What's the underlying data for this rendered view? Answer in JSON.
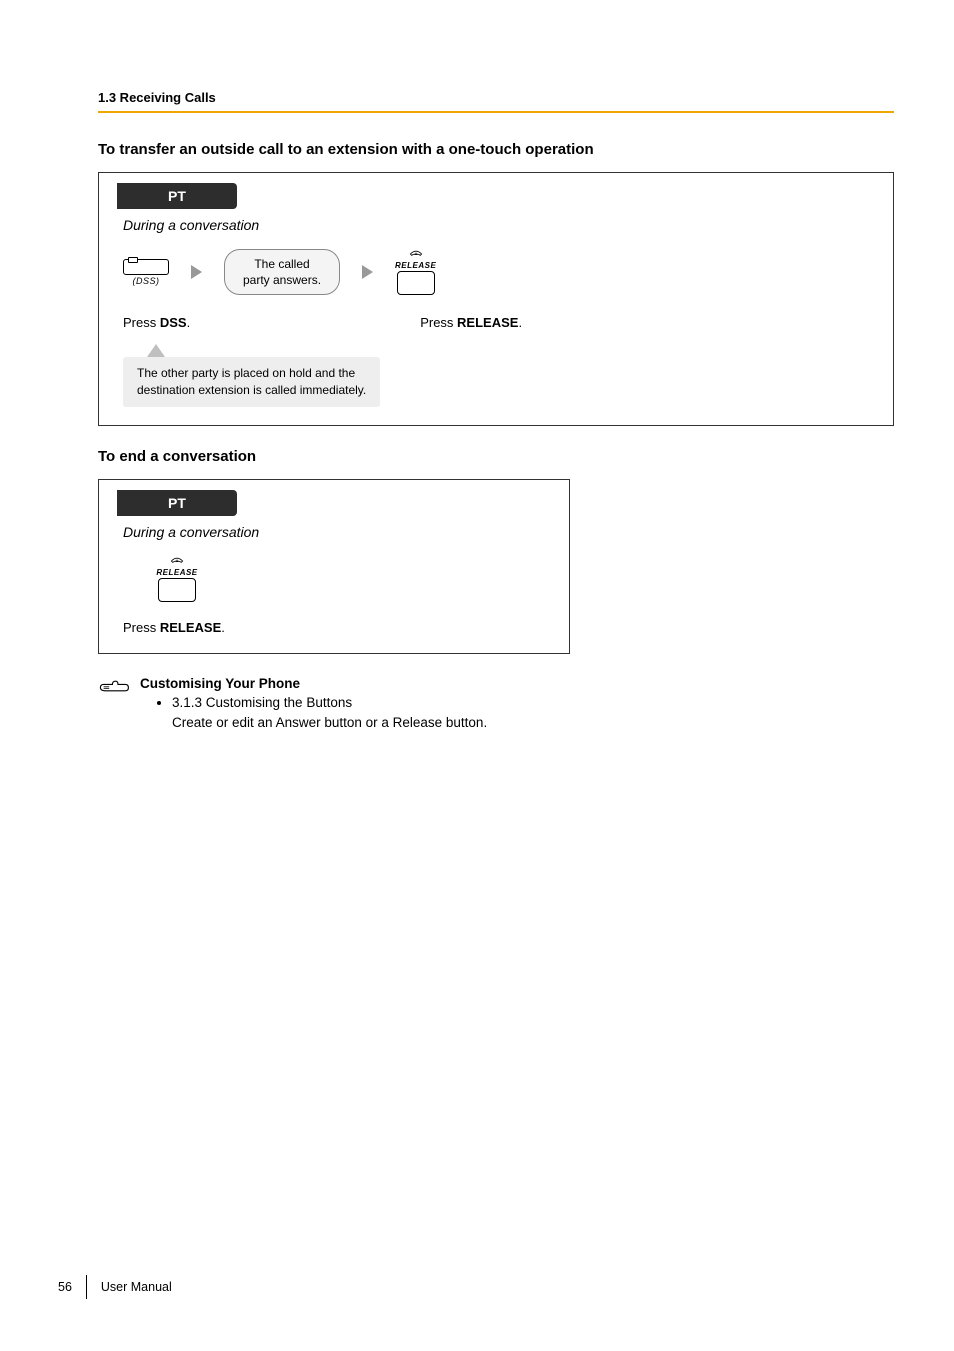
{
  "section_header": "1.3 Receiving Calls",
  "heading_transfer": "To transfer an outside call to an extension with a one-touch operation",
  "heading_end": "To end a conversation",
  "pt_tab": "PT",
  "context": "During a conversation",
  "dss_label": "(DSS)",
  "called_box": {
    "line1": "The called",
    "line2": "party answers."
  },
  "release_small_label": "RELEASE",
  "press_dss": "Press ",
  "press_dss_bold": "DSS",
  "press_release_prefix": "Press ",
  "press_release_bold": "RELEASE",
  "period": ".",
  "callout": {
    "line1": "The other party is placed on hold and the",
    "line2": "destination extension is called immediately."
  },
  "customising": {
    "title": "Customising Your Phone",
    "item": "3.1.3 Customising the Buttons",
    "desc": "Create or edit an Answer button or a Release button."
  },
  "footer": {
    "page": "56",
    "label": "User Manual"
  }
}
